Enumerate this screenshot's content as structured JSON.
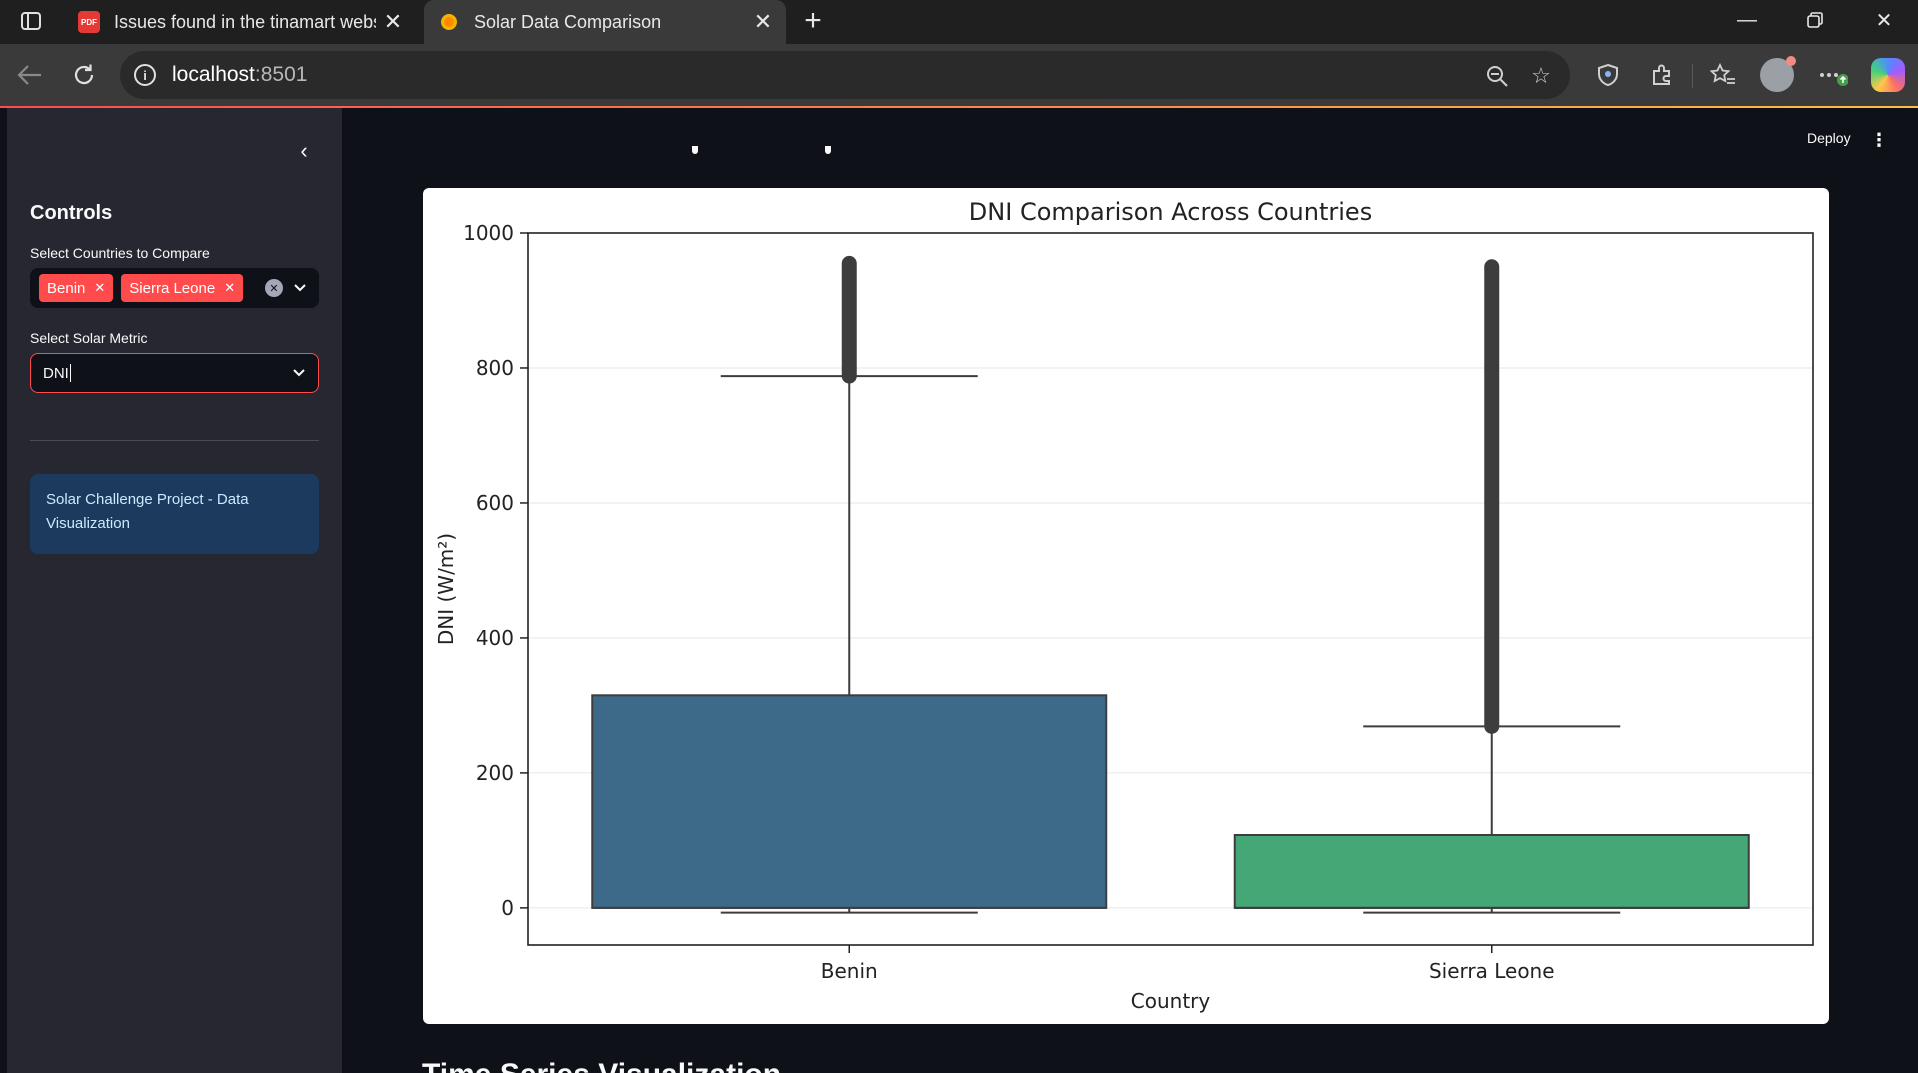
{
  "browser": {
    "tabs": [
      {
        "title": "Issues found in the tinamart webs",
        "favicon": "pdf-icon",
        "active": false
      },
      {
        "title": "Solar Data Comparison",
        "favicon": "streamlit-sun-icon",
        "active": true
      }
    ],
    "url_host": "localhost",
    "url_port": ":8501"
  },
  "sidebar": {
    "heading": "Controls",
    "countries_label": "Select Countries to Compare",
    "selected_countries": [
      "Benin",
      "Sierra Leone"
    ],
    "metric_label": "Select Solar Metric",
    "metric_value": "DNI",
    "info_text": "Solar Challenge Project - Data Visualization"
  },
  "header": {
    "deploy_label": "Deploy"
  },
  "bottom_heading_partial": "Time Series Visualization",
  "chart_data": {
    "type": "boxplot",
    "title": "DNI Comparison Across Countries",
    "xlabel": "Country",
    "ylabel": "DNI (W/m²)",
    "categories": [
      "Benin",
      "Sierra Leone"
    ],
    "ylim": [
      -55,
      1000
    ],
    "yticks": [
      0,
      200,
      400,
      600,
      800,
      1000
    ],
    "grid": true,
    "boxes": [
      {
        "name": "Benin",
        "whisker_low": -7,
        "q1": 0,
        "median": 0,
        "q3": 315,
        "whisker_high": 788,
        "outliers_from": 788,
        "outliers_to": 955,
        "color": "#3e6a8a"
      },
      {
        "name": "Sierra Leone",
        "whisker_low": -7,
        "q1": 0,
        "median": 0,
        "q3": 108,
        "whisker_high": 269,
        "outliers_from": 269,
        "outliers_to": 950,
        "color": "#44a775"
      }
    ]
  },
  "colors": {
    "accent": "#ff4b4b",
    "sidebar_bg": "#262730",
    "app_bg": "#0e1117",
    "info_bg": "#1c3a5e"
  }
}
